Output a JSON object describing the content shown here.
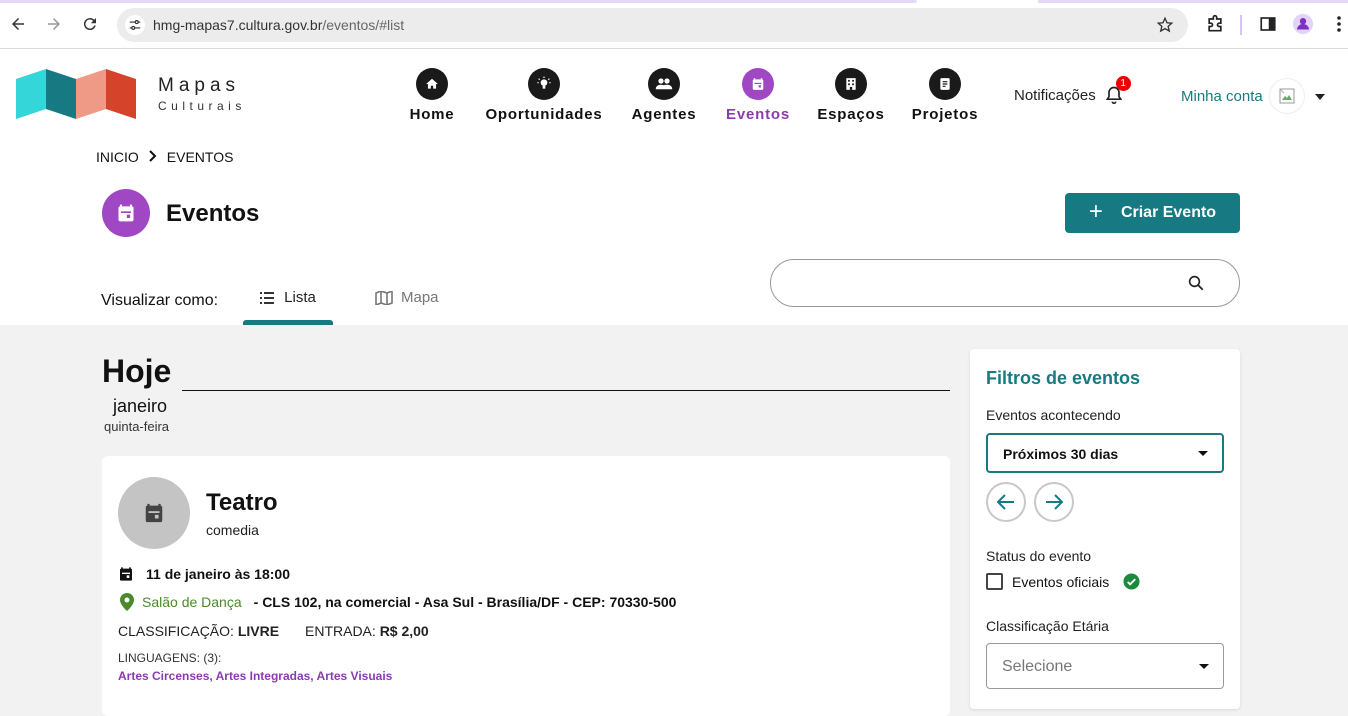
{
  "browser": {
    "url_host": "hmg-mapas7.cultura.gov.br",
    "url_path": "/eventos/#list"
  },
  "site": {
    "logo_line1": "Mapas",
    "logo_line2": "Culturais",
    "menu": [
      {
        "label": "Home",
        "icon": "home-icon"
      },
      {
        "label": "Oportunidades",
        "icon": "lightbulb-icon"
      },
      {
        "label": "Agentes",
        "icon": "people-icon"
      },
      {
        "label": "Eventos",
        "icon": "calendar-icon",
        "active": true
      },
      {
        "label": "Espaços",
        "icon": "building-icon"
      },
      {
        "label": "Projetos",
        "icon": "document-icon"
      }
    ],
    "notifications_label": "Notificações",
    "notifications_count": "1",
    "account_label": "Minha conta"
  },
  "colors": {
    "accent": "#177a82",
    "events": "#a048c4",
    "place": "#4a8a2a"
  },
  "breadcrumb": {
    "item1": "INICIO",
    "item2": "EVENTOS"
  },
  "page": {
    "title": "Eventos",
    "create_button": "Criar Evento",
    "view_as_label": "Visualizar como:",
    "tab_list": "Lista",
    "tab_map": "Mapa",
    "search_placeholder": ""
  },
  "day": {
    "heading": "Hoje",
    "month": "janeiro",
    "weekday": "quinta-feira"
  },
  "event": {
    "title": "Teatro",
    "subtitle": "comedia",
    "datetime": "11 de janeiro às 18:00",
    "place_name": "Salão de Dança",
    "address": "- CLS 102, na comercial - Asa Sul - Brasília/DF - CEP: 70330-500",
    "classification_label": "CLASSIFICAÇÃO:",
    "classification_value": "LIVRE",
    "entry_label": "ENTRADA:",
    "entry_value": "R$ 2,00",
    "languages_header": "LINGUAGENS: (3):",
    "languages": "Artes Circenses, Artes Integradas, Artes Visuais"
  },
  "filters": {
    "title": "Filtros de eventos",
    "happening_label": "Eventos acontecendo",
    "happening_value": "Próximos 30 dias",
    "status_label": "Status do evento",
    "official_label": "Eventos oficiais",
    "age_label": "Classificação Etária",
    "age_placeholder": "Selecione"
  }
}
